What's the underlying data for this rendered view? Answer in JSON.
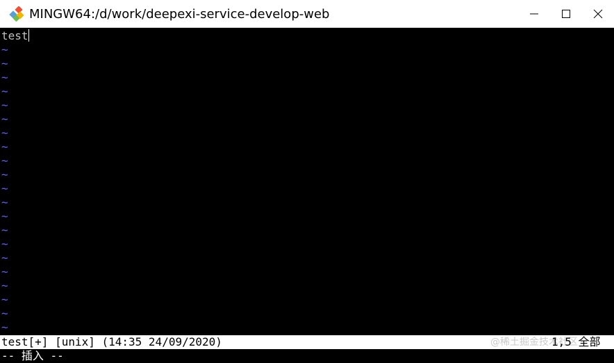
{
  "window": {
    "title": "MINGW64:/d/work/deepexi-service-develop-web",
    "icon": "git-bash-icon",
    "controls": [
      "minimize-icon",
      "maximize-icon",
      "close-icon"
    ]
  },
  "editor": {
    "lines": [
      "test"
    ],
    "empty_line_marker": "~",
    "empty_line_count": 21,
    "tilde_color": "#5f5fff"
  },
  "statusline": {
    "left": "test[+] [unix] (14:35 24/09/2020)",
    "right": "1,5 全部",
    "watermark": "@稀土掘金技术社区"
  },
  "modeline": {
    "text": "-- 插入 --"
  }
}
